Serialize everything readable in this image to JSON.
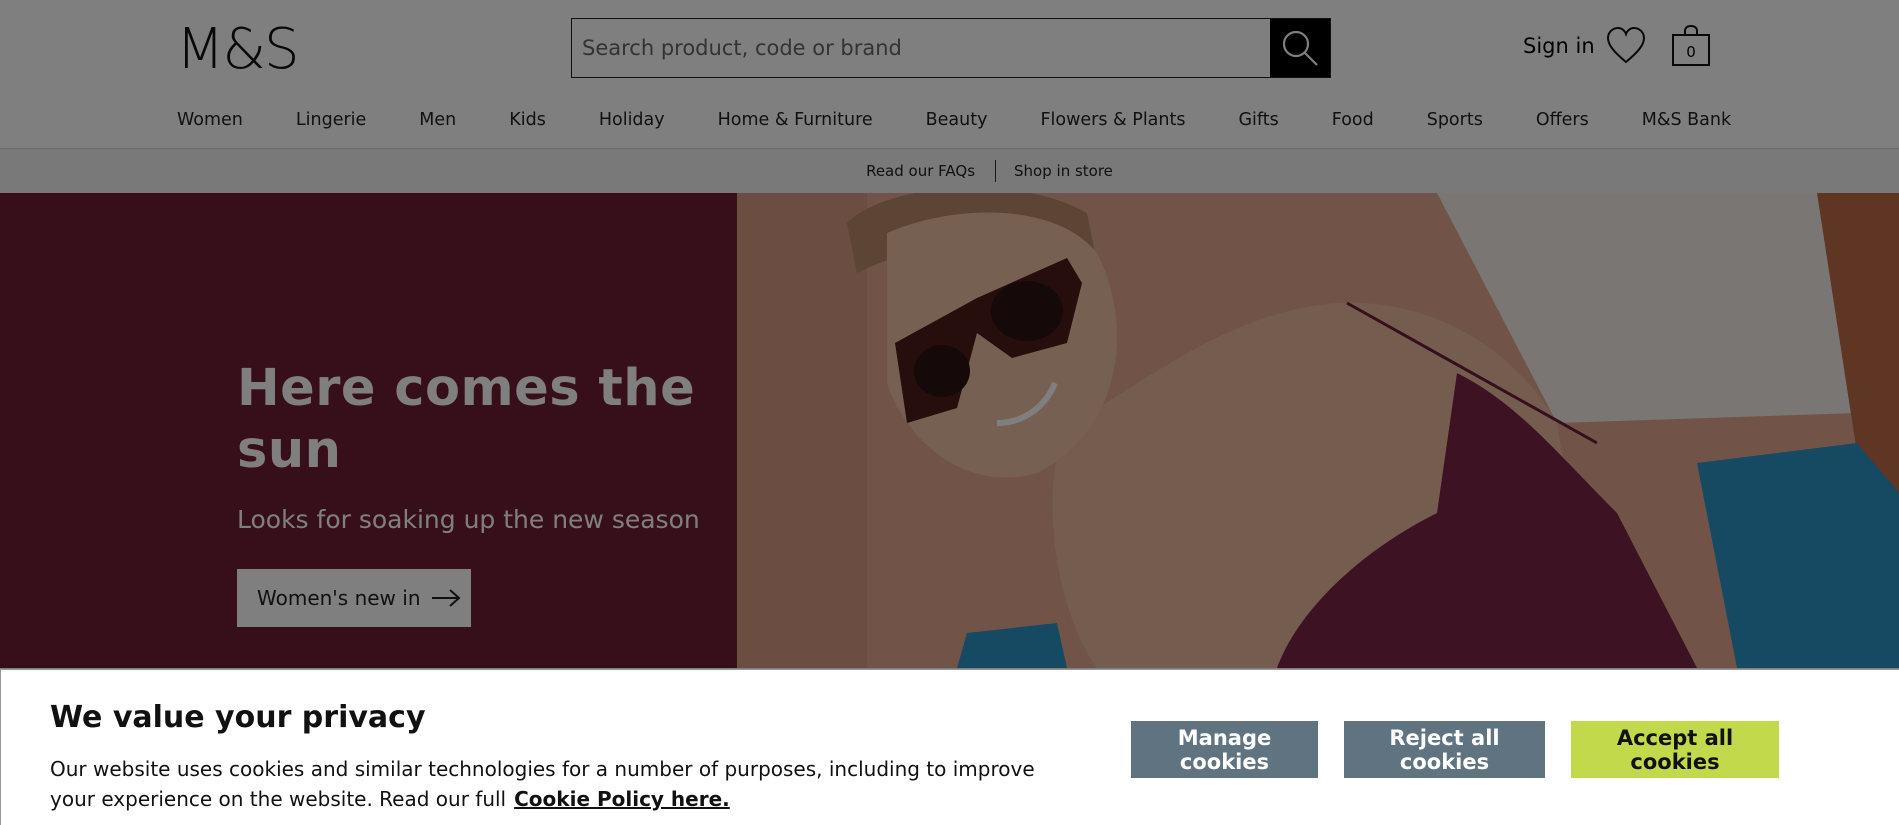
{
  "header": {
    "logo_text": "M&S",
    "search_placeholder": "Search product, code or brand",
    "sign_in": "Sign in",
    "bag_count": "0"
  },
  "nav": {
    "items": [
      {
        "label": "Women"
      },
      {
        "label": "Lingerie"
      },
      {
        "label": "Men"
      },
      {
        "label": "Kids"
      },
      {
        "label": "Holiday"
      },
      {
        "label": "Home & Furniture"
      },
      {
        "label": "Beauty"
      },
      {
        "label": "Flowers & Plants"
      },
      {
        "label": "Gifts"
      },
      {
        "label": "Food"
      },
      {
        "label": "Sports"
      },
      {
        "label": "Offers"
      },
      {
        "label": "M&S Bank"
      }
    ]
  },
  "subbar": {
    "faqs": "Read our FAQs",
    "shop_in_store": "Shop in store"
  },
  "hero": {
    "title": "Here comes the sun",
    "subtitle": "Looks for soaking up the new season",
    "cta": "Women's new in",
    "panel_color": "#6e1f35"
  },
  "cookie": {
    "title": "We value your privacy",
    "text": "Our website uses cookies and similar technologies for a number of purposes, including to improve your experience on the website. Read our full",
    "link": "Cookie Policy here.",
    "manage": "Manage cookies",
    "reject": "Reject all cookies",
    "accept": "Accept all cookies",
    "button_color": "#5f7381",
    "accept_color": "#c2d94b"
  }
}
